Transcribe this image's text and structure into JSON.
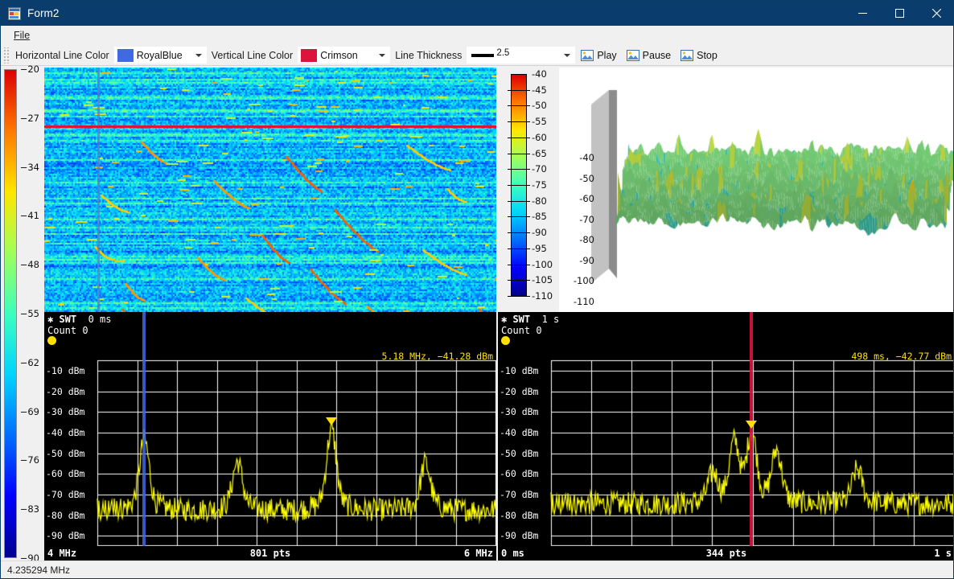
{
  "window": {
    "title": "Form2",
    "icon": "form-designer-icon",
    "minimize": "–",
    "maximize": "□",
    "close": "✕"
  },
  "menubar": {
    "items": [
      {
        "label": "File",
        "accel": "F"
      }
    ]
  },
  "toolbar": {
    "horizontal_line_color_label": "Horizontal Line Color",
    "horizontal_line_color_value": "RoyalBlue",
    "horizontal_line_color_hex": "#4169E1",
    "vertical_line_color_label": "Vertical Line Color",
    "vertical_line_color_value": "Crimson",
    "vertical_line_color_hex": "#DC143C",
    "line_thickness_label": "Line Thickness",
    "line_thickness_value": "2.5",
    "buttons": [
      {
        "label": "Play",
        "icon": "image-placeholder-icon"
      },
      {
        "label": "Pause",
        "icon": "image-placeholder-icon"
      },
      {
        "label": "Stop",
        "icon": "image-placeholder-icon"
      }
    ]
  },
  "statusbar": {
    "text": "4.235294 MHz"
  },
  "chart_data": [
    {
      "type": "heatmap",
      "name": "spectrogram-waterfall",
      "title": "",
      "colorbar_left": {
        "ticks": [
          -20,
          -27,
          -34,
          -41,
          -48,
          -55,
          -62,
          -69,
          -76,
          -83,
          -90
        ],
        "min": -90,
        "max": -20,
        "unit": "dBm"
      },
      "markers": {
        "horizontal_line_value": -36.5,
        "horizontal_line_color": "#DC143C",
        "vertical_line_color": "#6a74c8",
        "vertical_line_frac": 0.117
      }
    },
    {
      "type": "heatmap",
      "name": "amplitude-colorbar-legend",
      "ticks": [
        -40,
        -45,
        -50,
        -55,
        -60,
        -65,
        -70,
        -75,
        -80,
        -85,
        -90,
        -95,
        -100,
        -105,
        -110
      ],
      "min": -110,
      "max": -40,
      "unit": "dBm"
    },
    {
      "type": "area",
      "name": "surface-3d-waterfall",
      "zticks": [
        -40,
        -50,
        -60,
        -70,
        -80,
        -90,
        -100,
        -110
      ],
      "zmin": -110,
      "zmax": -40,
      "zlabel": "dBm"
    },
    {
      "type": "line",
      "name": "spectrum-frequency-domain",
      "header_label": "SWT",
      "header_value": "0 ms",
      "count_label": "Count 0",
      "annotation": "5.18 MHz, −41.28 dBm",
      "yticks": [
        "-10 dBm",
        "-20 dBm",
        "-30 dBm",
        "-40 dBm",
        "-50 dBm",
        "-60 dBm",
        "-70 dBm",
        "-80 dBm",
        "-90 dBm"
      ],
      "ylim": [
        -95,
        -5
      ],
      "xstart": "4 MHz",
      "xend": "6 MHz",
      "points": "801 pts",
      "xlim": [
        4,
        6
      ],
      "trace_color": "#ffff00",
      "cursor_color": "#4169E1",
      "cursor_frac": 0.117,
      "marker_frac": 0.588,
      "marker_level": -41.28,
      "peaks": [
        {
          "x_frac": 0.118,
          "level": -47.5
        },
        {
          "x_frac": 0.352,
          "level": -57.0
        },
        {
          "x_frac": 0.588,
          "level": -43.0
        },
        {
          "x_frac": 0.824,
          "level": -57.5
        }
      ],
      "noise_floor": -78
    },
    {
      "type": "line",
      "name": "spectrum-time-domain",
      "header_label": "SWT",
      "header_value": "1 s",
      "count_label": "Count 0",
      "annotation": "498 ms, −42.77 dBm",
      "yticks": [
        "-10 dBm",
        "-20 dBm",
        "-30 dBm",
        "-40 dBm",
        "-50 dBm",
        "-60 dBm",
        "-70 dBm",
        "-80 dBm",
        "-90 dBm"
      ],
      "ylim": [
        -95,
        -5
      ],
      "xstart": "0 ms",
      "xend": "1 s",
      "points": "344 pts",
      "xlim": [
        0,
        1000
      ],
      "trace_color": "#ffff00",
      "cursor_color": "#DC143C",
      "cursor_frac": 0.498,
      "marker_frac": 0.498,
      "marker_level": -42.77,
      "peaks": [
        {
          "x_frac": 0.402,
          "level": -62.0
        },
        {
          "x_frac": 0.455,
          "level": -49.0
        },
        {
          "x_frac": 0.498,
          "level": -45.0
        },
        {
          "x_frac": 0.56,
          "level": -52.0
        },
        {
          "x_frac": 0.76,
          "level": -60.0
        }
      ],
      "noise_floor": -75
    }
  ]
}
